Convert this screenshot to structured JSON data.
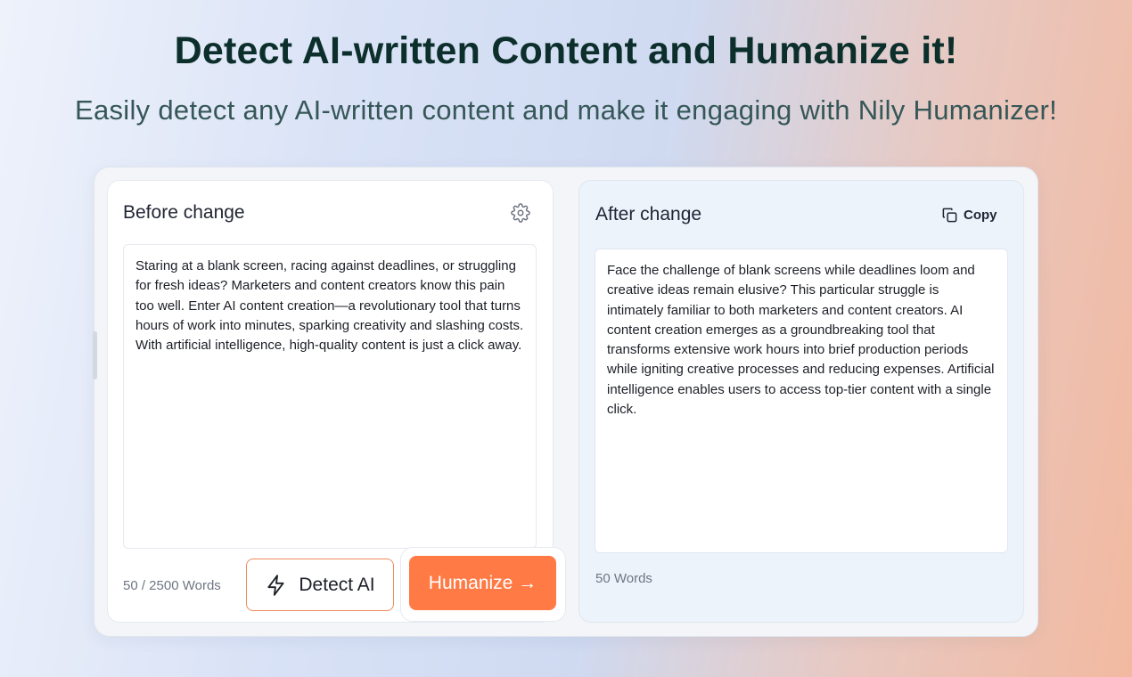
{
  "hero": {
    "title": "Detect AI-written Content and Humanize it!",
    "subtitle": "Easily detect any AI-written content and make it engaging with Nily Humanizer!"
  },
  "left_panel": {
    "title": "Before change",
    "settings_icon": "gear-icon",
    "input_text": "Staring at a blank screen, racing against deadlines, or struggling for fresh ideas? Marketers and content creators know this pain too well. Enter AI content creation—a revolutionary tool that turns hours of work into minutes, sparking creativity and slashing costs. With artificial intelligence, high-quality content is just a click away.",
    "word_count": "50 / 2500 Words",
    "detect_label": "Detect AI",
    "detect_icon": "lightning-icon",
    "humanize_label": "Humanize →"
  },
  "right_panel": {
    "title": "After change",
    "copy_label": "Copy",
    "copy_icon": "copy-icon",
    "output_text": "Face the challenge of blank screens while deadlines loom and creative ideas remain elusive? This particular struggle is intimately familiar to both marketers and content creators. AI content creation emerges as a groundbreaking tool that transforms extensive work hours into brief production periods while igniting creative processes and reducing expenses. Artificial intelligence enables users to access top-tier content with a single click.",
    "word_count": "50 Words"
  },
  "colors": {
    "accent": "#ff7a45",
    "title": "#0c2f2c",
    "subtitle": "#365757"
  }
}
